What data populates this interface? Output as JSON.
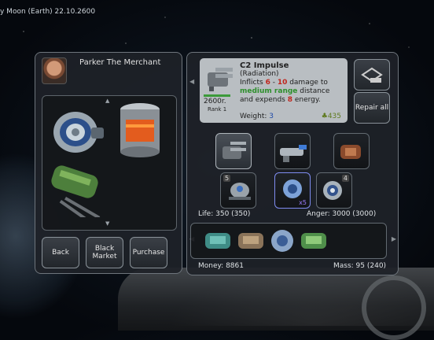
{
  "status_bar": {
    "location": "y Moon (Earth) 22.10.2600"
  },
  "merchant": {
    "name": "Parker The Merchant"
  },
  "inventory": {
    "items": [
      {
        "name": "ring-emitter-module"
      },
      {
        "name": "orange-fuel-canister"
      },
      {
        "name": "green-heavy-cannon"
      }
    ]
  },
  "buttons": {
    "back": "Back",
    "black_market": "Black Market",
    "purchase": "Purchase",
    "repair_all": "Repair all"
  },
  "item_info": {
    "title": "C2 Impulse",
    "subtitle": "(Radiation)",
    "desc_prefix": "Inflicts ",
    "dmg_min": "6",
    "dmg_sep": " - ",
    "dmg_max": "10",
    "desc_mid": " damage to ",
    "range": "medium range",
    "desc_mid2": " distance and expends ",
    "energy": "8",
    "desc_suffix": " energy.",
    "price": "2600r.",
    "rank": "Rank 1",
    "weight_label": "Weight: ",
    "weight": "3",
    "cost": "435"
  },
  "equipment_slots": [
    {
      "name": "twin-cannon",
      "badge": ""
    },
    {
      "name": "blaster-gun",
      "badge": ""
    },
    {
      "name": "copper-launcher",
      "badge": ""
    }
  ],
  "module_slots": [
    {
      "name": "drone-module",
      "badge": "5",
      "multiplier": ""
    },
    {
      "name": "blue-thruster",
      "badge": "",
      "multiplier": "x5"
    },
    {
      "name": "ring-emitter",
      "badge": "4",
      "multiplier": ""
    }
  ],
  "stats": {
    "life": "Life: 350 (350)",
    "anger": "Anger: 3000 (3000)",
    "money": "Money: 8861",
    "mass": "Mass: 95 (240)"
  },
  "cargo": [
    {
      "name": "teal-drone"
    },
    {
      "name": "brown-drone"
    },
    {
      "name": "blue-capsule"
    },
    {
      "name": "green-drone"
    }
  ]
}
